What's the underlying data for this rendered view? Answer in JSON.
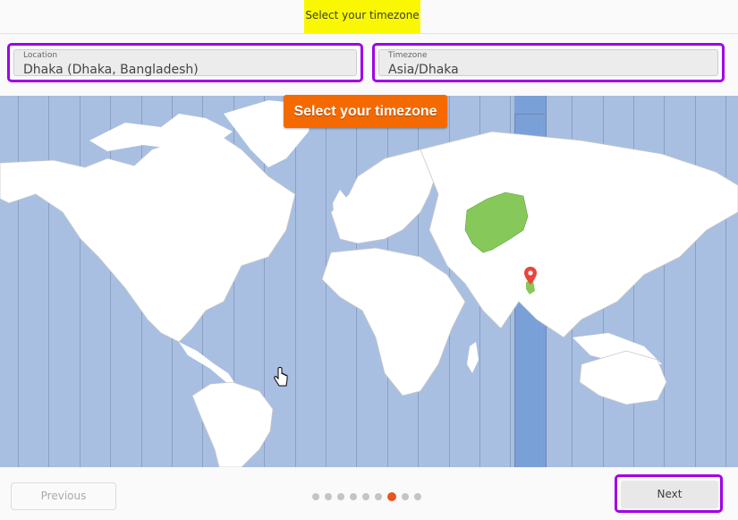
{
  "header": {
    "title": "Select your timezone"
  },
  "fields": {
    "location": {
      "label": "Location",
      "value": "Dhaka (Dhaka, Bangladesh)"
    },
    "timezone": {
      "label": "Timezone",
      "value": "Asia/Dhaka"
    }
  },
  "map": {
    "banner": "Select your timezone",
    "selected_location": "Dhaka",
    "highlight_color": "#86c95a",
    "selected_zone_color": "#7aa0d8",
    "ocean_color": "#a8bfe2",
    "marker_color": "#e8453c"
  },
  "footer": {
    "previous_label": "Previous",
    "next_label": "Next",
    "steps_total": 9,
    "current_step": 7,
    "accent": "#e95420"
  }
}
